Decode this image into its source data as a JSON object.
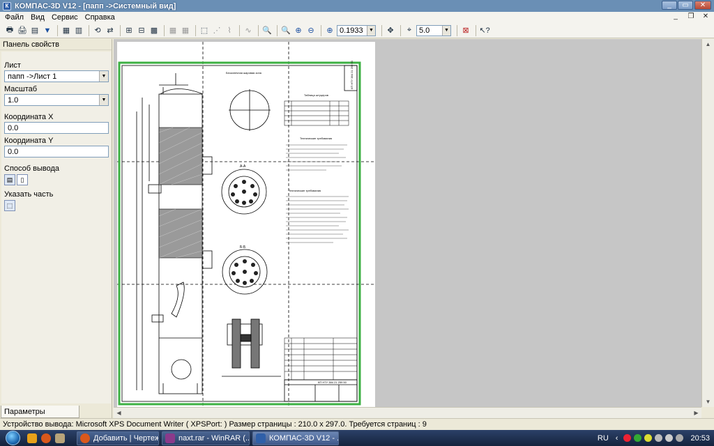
{
  "window": {
    "title": "КОМПАС-3D V12 - [папп ->Системный вид]",
    "app_icon": "К"
  },
  "menu": {
    "items": [
      "Файл",
      "Вид",
      "Сервис",
      "Справка"
    ]
  },
  "toolbar": {
    "zoom_value": "0.1933",
    "step_value": "5.0"
  },
  "panel": {
    "title": "Панель свойств",
    "sheet_label": "Лист",
    "sheet_value": "папп ->Лист 1",
    "scale_label": "Масштаб",
    "scale_value": "1.0",
    "coord_x_label": "Координата X",
    "coord_x_value": "0.0",
    "coord_y_label": "Координата Y",
    "coord_y_value": "0.0",
    "output_mode_label": "Способ вывода",
    "select_part_label": "Указать часть",
    "tab_label": "Параметры просмотра"
  },
  "drawing": {
    "title_block_number": "КП НТУ 384 21 259 50",
    "heading_top": "Бесконечная шаровая зона",
    "section_a": "А-А",
    "section_b": "Б-Б",
    "table_title": "Таблица штуцеров",
    "notes_title": "Технические требования",
    "notes2_title": "Технические требования"
  },
  "status": {
    "text": "Устройство вывода: Microsoft XPS Document Writer ( XPSPort: )  Размер страницы : 210.0 x 297.0.  Требуется страниц : 9"
  },
  "taskbar": {
    "tasks": [
      "Добавить | Чертеж...",
      "naxt.rar - WinRAR (...",
      "КОМПАС-3D V12 - ..."
    ],
    "language": "RU",
    "clock": "20:53"
  },
  "colors": {
    "frame_green": "#3cb043",
    "titlebar": "#6a8fb5",
    "workspace": "#c6c6c6"
  }
}
